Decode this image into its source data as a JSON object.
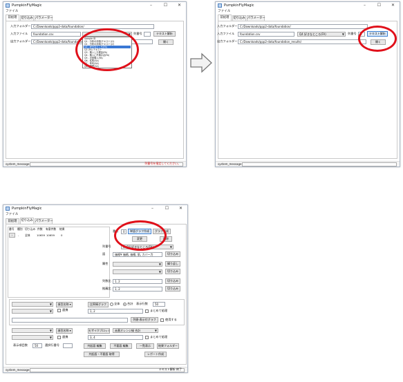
{
  "app": {
    "title": "PumpkinFlyMagic",
    "menu": "ファイル",
    "tabs": [
      "前処理",
      "切り込み",
      "パラメーター"
    ],
    "window_controls": [
      "–",
      "☐",
      "✕"
    ]
  },
  "status": {
    "label": "system_message",
    "msg1": "列番号を指定してください。",
    "msg3": "テキスト解析 終了"
  },
  "win1": {
    "input_folder_label": "入力フォルダー",
    "input_folder_value": "C:/Downloads/ppp2-data/foundation/",
    "input_file_label": "入力ファイル",
    "input_file_value": "foundation.csv",
    "col_label": "列番号",
    "text_btn": "テキスト解析",
    "output_folder_label": "出力フォルダー",
    "output_folder_value": "C:/Downloads/ppp2-data/foundation/",
    "open_btn": "開く",
    "dropdown_items": [
      "Sample ID",
      "Q1 - 分析の手順(テキスト)(1)",
      "Q1 - 分析の手順(テキスト)(2)",
      "Q2 - 好きなところ(FA)",
      "Q2 (FA) テキスト",
      "Q3 - 購入した理由(FA)",
      "Q4 - 購入に不満の点(FA)",
      "Q5 - 次回購入(FA)",
      "Q6 - 性別(SA)",
      "Q7 - 年代(SA)",
      "Q8 - 職業(SA)"
    ]
  },
  "win2": {
    "input_folder_label": "入力フォルダー",
    "input_folder_value": "C:/Downloads/ppp2-data/foundation/",
    "input_file_label": "入力ファイル",
    "input_file_value": "foundation.csv",
    "combo_value": "Q4 好きなところ(FA)",
    "col_label": "列番号",
    "col_value": "5",
    "text_btn": "テキスト解析",
    "output_folder_label": "出力フォルダー",
    "output_folder_value": "C:/Downloads/ppp2-data/foundation_results/",
    "open_btn": "開く"
  },
  "win3": {
    "list_headers": [
      "番号",
      "種別",
      "切り込み",
      "件数",
      "有意件数",
      "結果"
    ],
    "list_row": [
      "-",
      "-",
      "全体",
      "10659",
      "10659",
      "0"
    ],
    "no_label": "番号",
    "no_value": "0",
    "btn_word_graph": "単語グラフ作成",
    "btn_graph": "グラフ作成",
    "btn_change": "変更",
    "btn_delete": "削除",
    "col_label": "列番号",
    "col_value": "4: Q4 好きなところ(FA)",
    "word_label": "語",
    "word_value": "価格¥ 価格, 価格, 肌, カバー力",
    "btn_cut": "切り込み",
    "attr_label": "属性",
    "btn_repeat": "繰り返し",
    "count_label": "列数比",
    "count_value": "1, 2",
    "ratio_label": "推薦比",
    "ratio_value": "1, 2",
    "item_name_label": "項目名称",
    "link_label": "連携",
    "bar_graph_btn": "比率棒グラフ",
    "whole_label": "全体",
    "total_label": "合計",
    "display_rows_label": "表示行数",
    "display_rows_value": "50",
    "merge_label": "まとめて処理",
    "bar_value": "1, 2",
    "list_graph_btn": "列値-表示付グラフ",
    "use_label": "使用する",
    "mosaic_btn": "モザイクプロット",
    "mosaic_combo": "赤黄オレンジ緑 合計",
    "mosaic_value": "3, 4",
    "display_items_label": "表示項目数",
    "display_items_value": "50",
    "select_row_label": "選択行番号",
    "btn_cooccurrence": "共起語 編集",
    "btn_unneeded": "不要語 編集",
    "btn_bulk": "一覧表示",
    "btn_result_folder": "結果フォルダー",
    "btn_cooc_unneeded": "共起語・不要語 取得",
    "btn_report": "レポート作成"
  }
}
